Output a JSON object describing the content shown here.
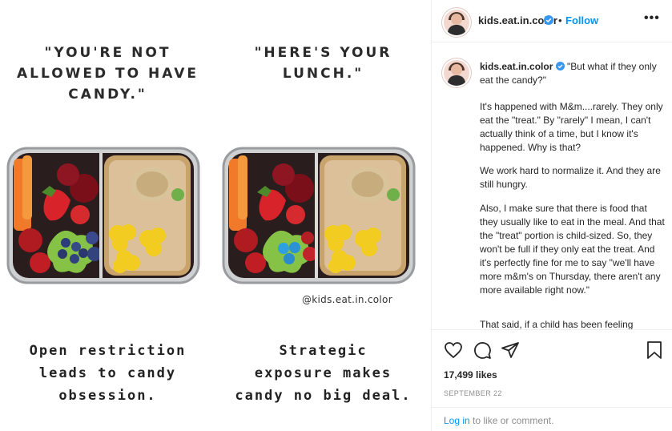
{
  "post": {
    "panels": [
      {
        "quote": "\"YOU'RE NOT\nALLOWED TO HAVE\nCANDY.\"",
        "caption": "Open restriction\nleads to candy\nobsession.",
        "watermark": ""
      },
      {
        "quote": "\"HERE'S YOUR\nLUNCH.\"",
        "caption": "Strategic\nexposure makes\ncandy no big deal.",
        "watermark": "@kids.eat.in.color"
      }
    ]
  },
  "header": {
    "username": "kids.eat.in.color",
    "separator": "•",
    "follow_label": "Follow",
    "more_label": "•••"
  },
  "caption": {
    "username": "kids.eat.in.color",
    "first_line": "\"But what if they only eat the candy?\"",
    "paragraphs": [
      "It's happened with M&m....rarely. They only eat the \"treat.\" By \"rarely\" I mean, I can't actually think of a time, but I know it's happened. Why is that?",
      "We work hard to normalize it. And they are still hungry.",
      "Also, I make sure that there is food that they usually like to eat in the meal. And that the \"treat\" portion is child-sized. So, they won't be full if they only eat the treat. And it's perfectly fine for me to say \"we'll have more m&m's on Thursday, there aren't any more available right now.\"",
      "That said, if a child has been feeling"
    ]
  },
  "engagement": {
    "likes": "17,499 likes",
    "date": "SEPTEMBER 22"
  },
  "login": {
    "link": "Log in",
    "rest": " to like or comment."
  },
  "icons": [
    "heart-icon",
    "comment-icon",
    "share-icon",
    "bookmark-icon",
    "verified-badge-icon",
    "more-options-icon"
  ],
  "colors": {
    "accent": "#0095f6",
    "muted": "#8e8e8e",
    "text": "#262626"
  }
}
